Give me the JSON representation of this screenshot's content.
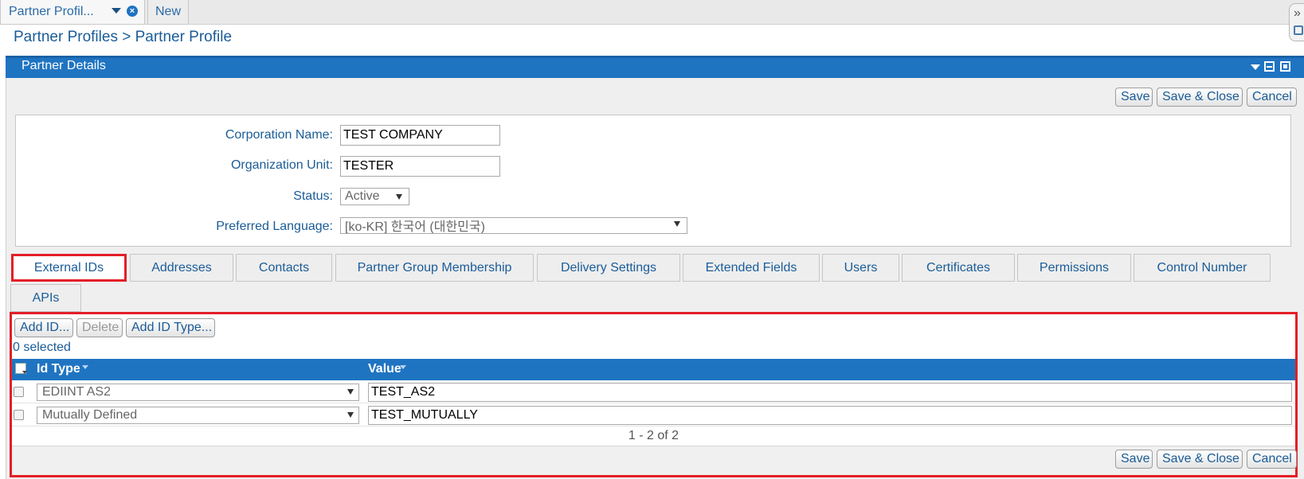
{
  "doc_tabs": [
    {
      "label": "Partner Profil..."
    },
    {
      "label": "New"
    }
  ],
  "breadcrumb": "Partner Profiles > Partner Profile",
  "panel": {
    "title": "Partner Details",
    "accent_color": "#1f74c2",
    "highlight_color": "#e41e26"
  },
  "toolbar": {
    "save_label": "Save",
    "save_close_label": "Save & Close",
    "cancel_label": "Cancel"
  },
  "form": {
    "corporation_name_label": "Corporation Name:",
    "corporation_name_value": "TEST COMPANY",
    "organization_unit_label": "Organization Unit:",
    "organization_unit_value": "TESTER",
    "status_label": "Status:",
    "status_value": "Active",
    "language_label": "Preferred Language:",
    "language_value": "[ko-KR] 한국어 (대한민국)"
  },
  "subtabs": [
    {
      "label": "External IDs",
      "active": true
    },
    {
      "label": "Addresses"
    },
    {
      "label": "Contacts"
    },
    {
      "label": "Partner Group Membership"
    },
    {
      "label": "Delivery Settings"
    },
    {
      "label": "Extended Fields"
    },
    {
      "label": "Users"
    },
    {
      "label": "Certificates"
    },
    {
      "label": "Permissions"
    },
    {
      "label": "Control Number"
    },
    {
      "label": "APIs"
    }
  ],
  "ids": {
    "add_id_label": "Add ID...",
    "delete_label": "Delete",
    "add_id_type_label": "Add ID Type...",
    "selected_text": "0 selected",
    "columns": [
      "Id Type",
      "Value"
    ],
    "rows": [
      {
        "id_type": "EDIINT AS2",
        "value": "TEST_AS2"
      },
      {
        "id_type": "Mutually Defined",
        "value": "TEST_MUTUALLY"
      }
    ],
    "pager_text": "1 - 2 of 2"
  },
  "icons": {
    "tab_close": "close-circle-icon",
    "tab_menu": "chevron-down-icon",
    "panel_collapse": "chevron-down-icon",
    "panel_minimize": "minimize-icon",
    "panel_maximize": "maximize-icon",
    "edge_expand": "double-chevron-right-icon"
  }
}
